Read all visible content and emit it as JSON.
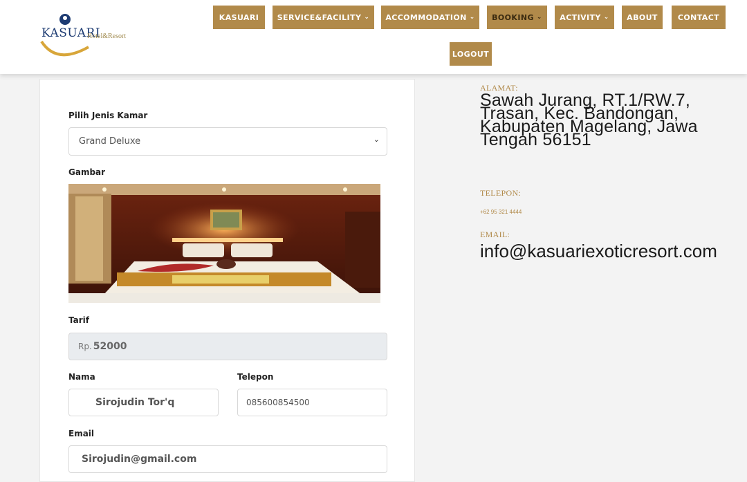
{
  "brand": {
    "name": "KASUARI",
    "subtitle": "Hotel&Resort"
  },
  "nav": {
    "items": [
      {
        "label": "KASUARI"
      },
      {
        "label": "SERVICE&FACILITY",
        "dropdown": true
      },
      {
        "label": "ACCOMMODATION",
        "dropdown": true
      },
      {
        "label": "BOOKING",
        "dropdown": true,
        "active": true
      },
      {
        "label": "ACTIVITY",
        "dropdown": true
      },
      {
        "label": "ABOUT"
      },
      {
        "label": "CONTACT"
      }
    ],
    "logout": "LOGOUT",
    "chevron": "⌄"
  },
  "form": {
    "room_type_label": "Pilih Jenis Kamar",
    "room_type_value": "Grand Deluxe",
    "image_label": "Gambar",
    "rate_label": "Tarif",
    "rate_prefix": "Rp.",
    "rate_value": "52000",
    "name_label": "Nama",
    "name_value": "Sirojudin Tor'q",
    "phone_label": "Telepon",
    "phone_value": "085600854500",
    "email_label": "Email",
    "email_value": "Sirojudin@gmail.com"
  },
  "contact": {
    "address_heading": "ALAMAT:",
    "address": "Sawah Jurang, RT.1/RW.7, Trasan, Kec. Bandongan, Kabupaten Magelang, Jawa Tengah 56151",
    "phone_heading": "TELEPON:",
    "phone": "+62 95 321 4444",
    "email_heading": "EMAIL:",
    "email": "info@kasuariexoticresort.com"
  },
  "colors": {
    "accent": "#b18a4a",
    "logo_blue": "#1d3b72"
  }
}
